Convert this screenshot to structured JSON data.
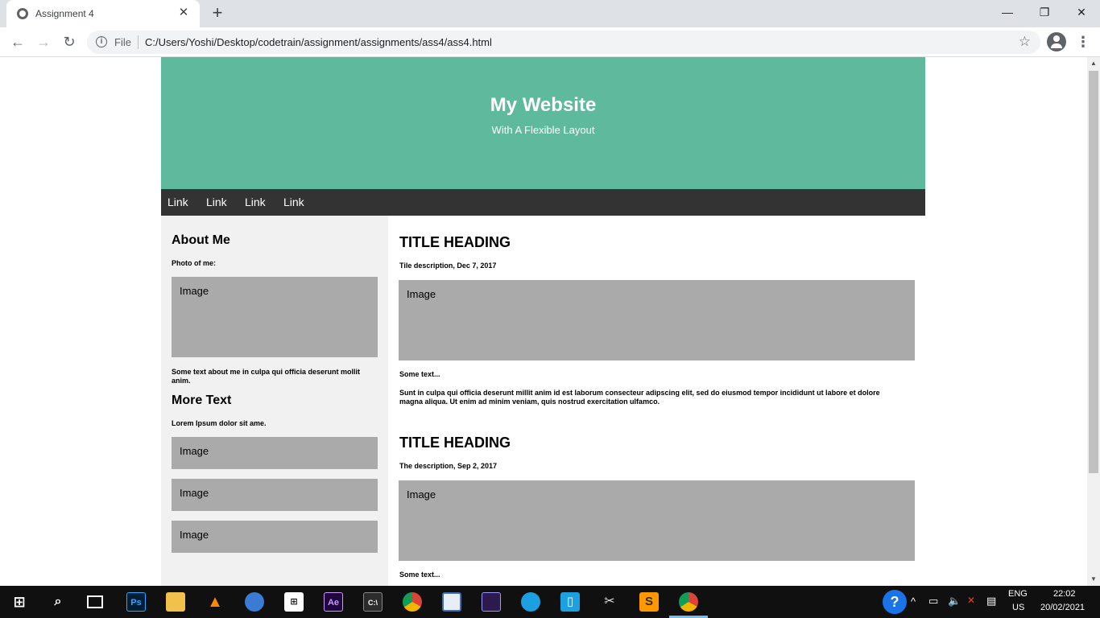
{
  "browser": {
    "tab_title": "Assignment 4",
    "tab_close": "✕",
    "new_tab": "+",
    "scheme_label": "File",
    "url": "C:/Users/Yoshi/Desktop/codetrain/assignment/assignments/ass4/ass4.html",
    "window_buttons": {
      "minimize": "—",
      "restore": "❐",
      "close": "✕"
    }
  },
  "site": {
    "title": "My Website",
    "subtitle": "With A Flexible Layout",
    "nav": [
      "Link",
      "Link",
      "Link",
      "Link"
    ],
    "sidebar": {
      "about_heading": "About Me",
      "photo_label": "Photo of me:",
      "image_label": "Image",
      "about_text": "Some text about me in culpa qui officia deserunt mollit anim.",
      "more_heading": "More Text",
      "more_text": "Lorem Ipsum dolor sit ame.",
      "images": [
        "Image",
        "Image",
        "Image"
      ]
    },
    "posts": [
      {
        "heading": "TITLE HEADING",
        "description": "Tile description, Dec 7, 2017",
        "image_label": "Image",
        "lead": "Some text...",
        "body": "Sunt in culpa qui officia deserunt millit anim id est laborum consecteur adipscing elit, sed do eiusmod tempor incididunt ut labore et dolore magna aliqua. Ut enim ad minim veniam, quis nostrud exercitation ulfamco."
      },
      {
        "heading": "TITLE HEADING",
        "description": "The description, Sep 2, 2017",
        "image_label": "Image",
        "lead": "Some text..."
      }
    ]
  },
  "taskbar": {
    "apps": [
      "photoshop-icon",
      "file-explorer-icon",
      "vlc-icon",
      "browser-icon",
      "store-icon",
      "after-effects-icon",
      "terminal-icon",
      "chrome-icon",
      "app-icon",
      "premiere-icon",
      "app-icon",
      "app-icon",
      "app-icon",
      "sublime-icon",
      "chrome-icon"
    ],
    "language": "ENG",
    "region": "US",
    "time": "22:02",
    "date": "20/02/2021"
  }
}
